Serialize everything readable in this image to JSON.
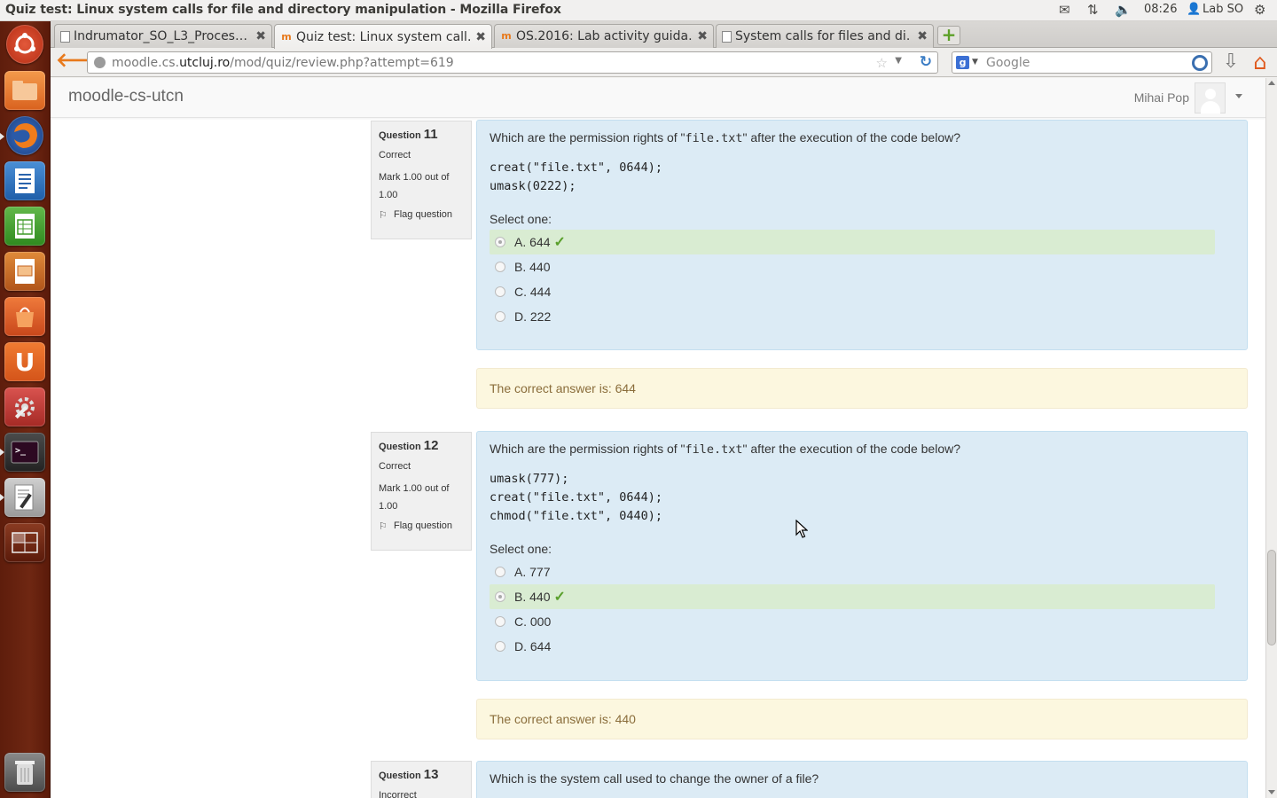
{
  "window": {
    "title": "Quiz test: Linux system calls for file and directory manipulation - Mozilla Firefox"
  },
  "tray": {
    "time": "08:26",
    "user": "Lab SO"
  },
  "launcher": {
    "items": [
      "ubuntu-dash-icon",
      "files-icon",
      "firefox-icon",
      "writer-icon",
      "calc-icon",
      "impress-icon",
      "software-center-icon",
      "ubuntu-one-icon",
      "system-settings-icon",
      "terminal-icon",
      "text-editor-icon",
      "workspace-switcher-icon",
      "trash-icon"
    ]
  },
  "tabs": [
    {
      "label": "Indrumator_SO_L3_Proces…",
      "active": false
    },
    {
      "label": "Quiz test: Linux system call…",
      "active": true
    },
    {
      "label": "OS.2016: Lab activity guida…",
      "active": false
    },
    {
      "label": "System calls for files and di…",
      "active": false
    }
  ],
  "nav": {
    "url_prefix": "moodle.cs.",
    "url_domain": "utcluj.ro",
    "url_path": "/mod/quiz/review.php?attempt=619",
    "search_placeholder": "Google"
  },
  "moodle": {
    "site_name": "moodle-cs-utcn",
    "user_name": "Mihai Pop"
  },
  "questions": [
    {
      "label": "Question",
      "number": "11",
      "state": "Correct",
      "grade": "Mark 1.00 out of 1.00",
      "flag": "Flag question",
      "text_before": "Which are the permission rights of \"",
      "text_code": "file.txt",
      "text_after": "\" after the execution of the code below?",
      "code": "creat(\"file.txt\", 0644);\numask(0222);",
      "prompt": "Select one:",
      "answers": [
        {
          "letter": "A.",
          "value": "644",
          "selected": true,
          "correct": true
        },
        {
          "letter": "B.",
          "value": "440",
          "selected": false,
          "correct": false
        },
        {
          "letter": "C.",
          "value": "444",
          "selected": false,
          "correct": false
        },
        {
          "letter": "D.",
          "value": "222",
          "selected": false,
          "correct": false
        }
      ],
      "right_answer": "The correct answer is: 644"
    },
    {
      "label": "Question",
      "number": "12",
      "state": "Correct",
      "grade": "Mark 1.00 out of 1.00",
      "flag": "Flag question",
      "text_before": "Which are the permission rights of \"",
      "text_code": "file.txt",
      "text_after": "\" after the execution of the code below?",
      "code": "umask(777);\ncreat(\"file.txt\", 0644);\nchmod(\"file.txt\", 0440);",
      "prompt": "Select one:",
      "answers": [
        {
          "letter": "A.",
          "value": "777",
          "selected": false,
          "correct": false
        },
        {
          "letter": "B.",
          "value": "440",
          "selected": true,
          "correct": true
        },
        {
          "letter": "C.",
          "value": "000",
          "selected": false,
          "correct": false
        },
        {
          "letter": "D.",
          "value": "644",
          "selected": false,
          "correct": false
        }
      ],
      "right_answer": "The correct answer is: 440"
    },
    {
      "label": "Question",
      "number": "13",
      "state": "Incorrect",
      "text": "Which is the system call used to change the owner of a file?"
    }
  ],
  "colors": {
    "launcher_bg": "#6f2712",
    "formulation_bg": "#dcebf5",
    "correct_bg": "#d9ecd2",
    "outcome_bg": "#fcf7df",
    "outcome_text": "#8a6d3b",
    "checkmark": "#5aa02c"
  }
}
